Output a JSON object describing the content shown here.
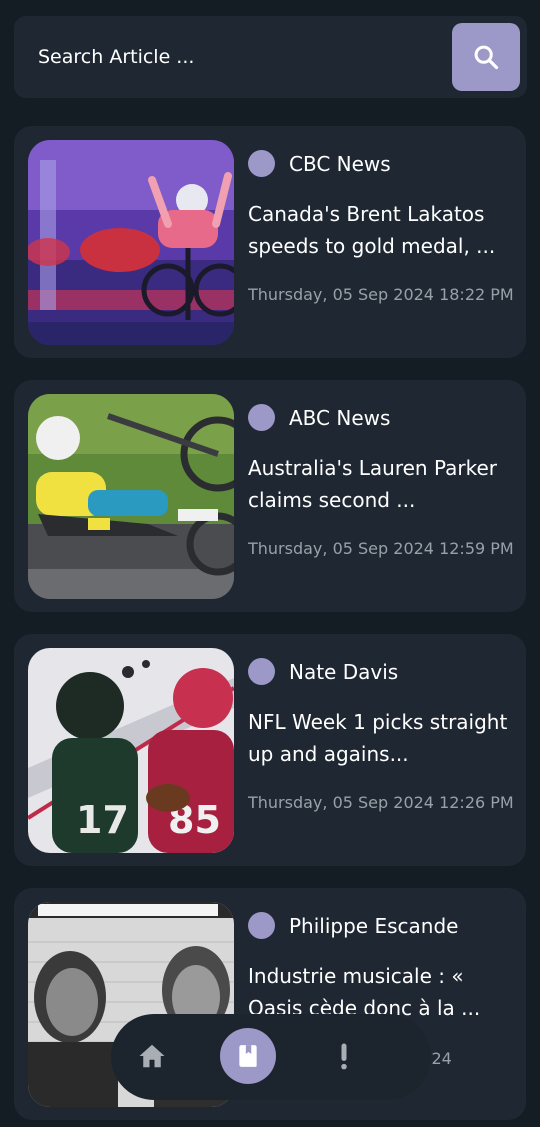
{
  "search": {
    "placeholder": "Search Article ..."
  },
  "articles": [
    {
      "source": "CBC News",
      "title": "Canada's Brent Lakatos speeds to gold medal, ...",
      "date": "Thursday, 05 Sep 2024 18:22 PM"
    },
    {
      "source": "ABC News",
      "title": "Australia's Lauren Parker claims second ...",
      "date": "Thursday, 05 Sep 2024 12:59 PM"
    },
    {
      "source": "Nate Davis",
      "title": "NFL Week 1 picks straight up and agains...",
      "date": "Thursday, 05 Sep 2024 12:26 PM"
    },
    {
      "source": "Philippe Escande",
      "title": "Industrie musicale : « Oasis cède donc à la ...",
      "date": "ep 2024"
    }
  ],
  "colors": {
    "background": "#141c24",
    "card": "#1f2832",
    "accent": "#9c98c8",
    "date_text": "#98a0a8"
  },
  "nav": {
    "items": [
      {
        "icon": "home-icon",
        "active": false
      },
      {
        "icon": "bookmark-icon",
        "active": true
      },
      {
        "icon": "exclamation-icon",
        "active": false
      }
    ]
  }
}
